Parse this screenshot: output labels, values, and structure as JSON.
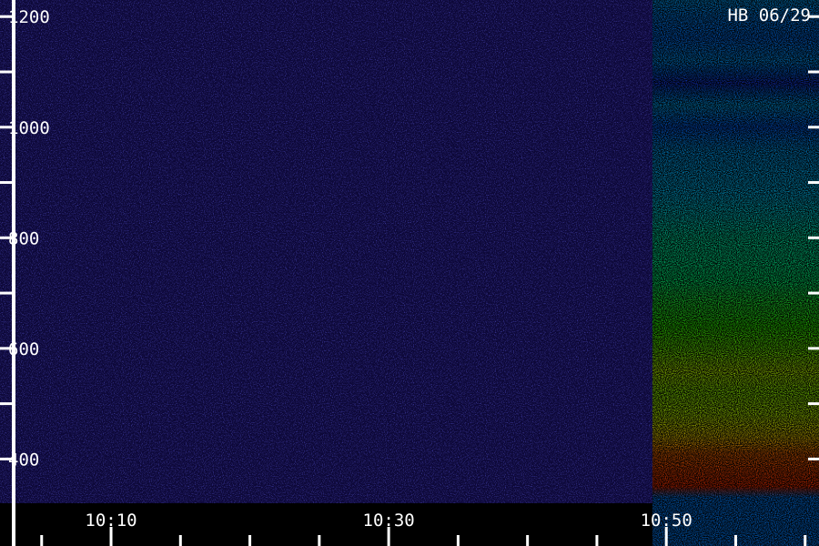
{
  "chart_data": {
    "type": "heatmap",
    "title": "HB 06/29",
    "y_ticks": [
      {
        "value": 400,
        "label": "400"
      },
      {
        "value": 600,
        "label": "600"
      },
      {
        "value": 800,
        "label": "800"
      },
      {
        "value": 1000,
        "label": "1000"
      },
      {
        "value": 1200,
        "label": "1200"
      }
    ],
    "ylim": [
      320,
      1230
    ],
    "x_ticks": [
      {
        "value": "10:10",
        "label": "10:10"
      },
      {
        "value": "10:30",
        "label": "10:30"
      },
      {
        "value": "10:50",
        "label": "10:50"
      }
    ],
    "xlim": [
      "10:02",
      "10:61"
    ],
    "minor_tick_interval_min": 5,
    "y_minor_tick_interval": 100,
    "quiet_period": {
      "start": "10:02",
      "end": "10:49",
      "level": 0.08
    },
    "burst_onset": "10:49",
    "burst_profile": [
      {
        "y": 330,
        "level": 0.25
      },
      {
        "y": 350,
        "level": 0.95
      },
      {
        "y": 380,
        "level": 0.92
      },
      {
        "y": 410,
        "level": 0.88
      },
      {
        "y": 440,
        "level": 0.76
      },
      {
        "y": 480,
        "level": 0.66
      },
      {
        "y": 520,
        "level": 0.63
      },
      {
        "y": 560,
        "level": 0.66
      },
      {
        "y": 600,
        "level": 0.6
      },
      {
        "y": 640,
        "level": 0.55
      },
      {
        "y": 680,
        "level": 0.52
      },
      {
        "y": 720,
        "level": 0.47
      },
      {
        "y": 760,
        "level": 0.44
      },
      {
        "y": 800,
        "level": 0.42
      },
      {
        "y": 840,
        "level": 0.37
      },
      {
        "y": 880,
        "level": 0.33
      },
      {
        "y": 920,
        "level": 0.31
      },
      {
        "y": 960,
        "level": 0.29
      },
      {
        "y": 1000,
        "level": 0.22
      },
      {
        "y": 1040,
        "level": 0.3
      },
      {
        "y": 1080,
        "level": 0.15
      },
      {
        "y": 1120,
        "level": 0.28
      },
      {
        "y": 1160,
        "level": 0.24
      },
      {
        "y": 1200,
        "level": 0.26
      },
      {
        "y": 1230,
        "level": 0.29
      }
    ],
    "colormap": [
      "#140a4a",
      "#1e1ecc",
      "#0064ff",
      "#00c8ff",
      "#00ff96",
      "#32ff00",
      "#c8ff00",
      "#ffc800",
      "#ff6400",
      "#f00000"
    ],
    "grid": false
  }
}
